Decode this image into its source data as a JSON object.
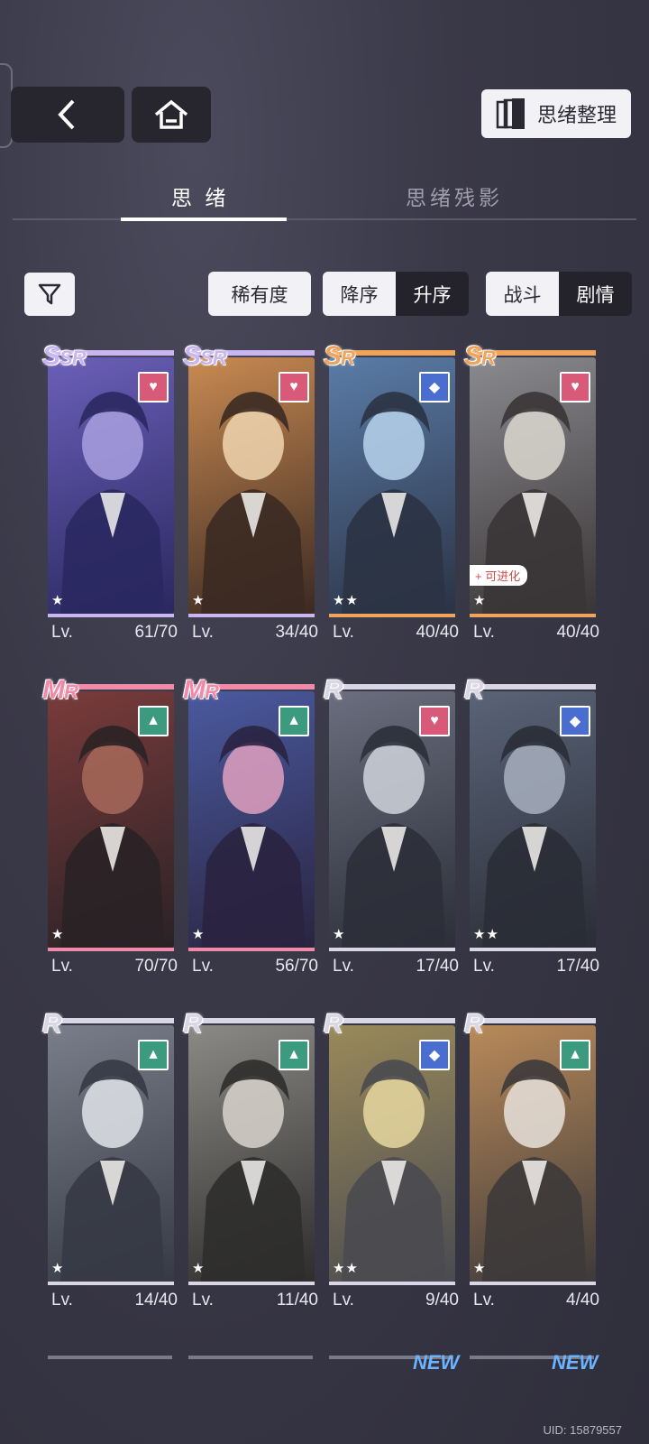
{
  "header": {
    "back_icon": "chevron-left-icon",
    "home_icon": "home-icon",
    "organize_label": "思绪整理",
    "organize_icon": "cards-stack-icon"
  },
  "tabs": [
    {
      "label": "思 绪",
      "active": true
    },
    {
      "label": "思绪残影",
      "active": false
    }
  ],
  "toolbar": {
    "filter_icon": "funnel-icon",
    "sort_by": "稀有度",
    "order": {
      "desc": "降序",
      "asc": "升序",
      "selected": "desc"
    },
    "type": {
      "battle": "战斗",
      "story": "剧情",
      "selected": "battle"
    }
  },
  "cards": [
    {
      "rarity": "S",
      "rarity_small": "SR",
      "badge": "heart",
      "stars": "★",
      "lv_label": "Lv.",
      "lv": "61/70"
    },
    {
      "rarity": "S",
      "rarity_small": "SR",
      "badge": "heart",
      "stars": "★",
      "lv_label": "Lv.",
      "lv": "34/40"
    },
    {
      "rarity": "S",
      "rarity_small": "R",
      "badge": "diamond",
      "stars": "★★",
      "lv_label": "Lv.",
      "lv": "40/40"
    },
    {
      "rarity": "S",
      "rarity_small": "R",
      "badge": "heart",
      "stars": "★",
      "lv_label": "Lv.",
      "lv": "40/40",
      "tag": "+ 可进化"
    },
    {
      "rarity": "M",
      "rarity_small": "R",
      "badge": "tri",
      "stars": "★",
      "lv_label": "Lv.",
      "lv": "70/70"
    },
    {
      "rarity": "M",
      "rarity_small": "R",
      "badge": "tri",
      "stars": "★",
      "lv_label": "Lv.",
      "lv": "56/70"
    },
    {
      "rarity": "R",
      "rarity_small": "",
      "badge": "heart",
      "stars": "★",
      "lv_label": "Lv.",
      "lv": "17/40"
    },
    {
      "rarity": "R",
      "rarity_small": "",
      "badge": "diamond",
      "stars": "★★",
      "lv_label": "Lv.",
      "lv": "17/40"
    },
    {
      "rarity": "R",
      "rarity_small": "",
      "badge": "tri",
      "stars": "★",
      "lv_label": "Lv.",
      "lv": "14/40"
    },
    {
      "rarity": "R",
      "rarity_small": "",
      "badge": "tri",
      "stars": "★",
      "lv_label": "Lv.",
      "lv": "11/40"
    },
    {
      "rarity": "R",
      "rarity_small": "",
      "badge": "diamond",
      "stars": "★★",
      "lv_label": "Lv.",
      "lv": "9/40"
    },
    {
      "rarity": "R",
      "rarity_small": "",
      "badge": "tri",
      "stars": "★",
      "lv_label": "Lv.",
      "lv": "4/40"
    }
  ],
  "partial_row": {
    "new_label": "NEW"
  },
  "uid": "UID: 15879557",
  "colors": {
    "ssr_bar": "#c9b6f0",
    "sr_bar": "#f0a35a",
    "mr_bar": "#f08aa8",
    "r_bar": "#d9d6e6"
  }
}
